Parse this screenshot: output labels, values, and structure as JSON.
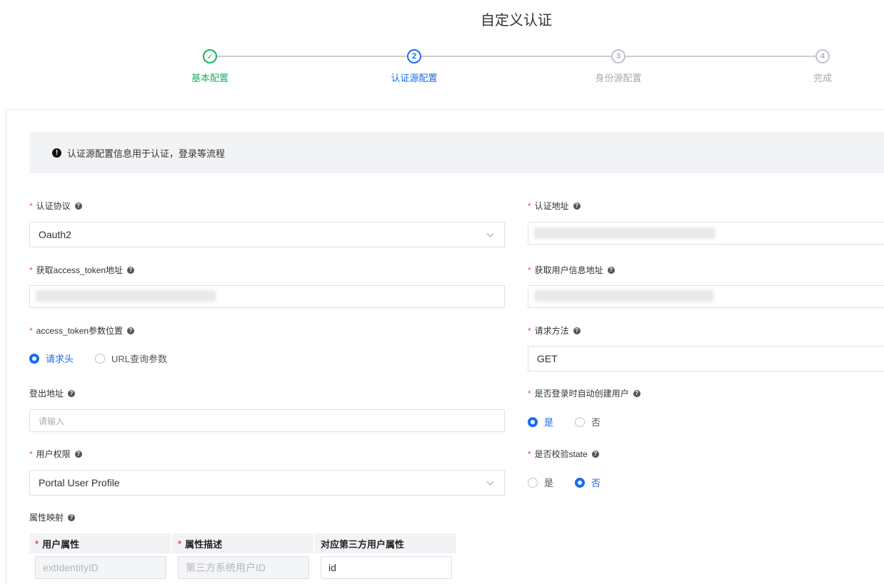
{
  "page": {
    "title": "自定义认证"
  },
  "stepper": {
    "steps": [
      {
        "number": "✓",
        "label": "基本配置",
        "state": "done"
      },
      {
        "number": "2",
        "label": "认证源配置",
        "state": "active"
      },
      {
        "number": "3",
        "label": "身份源配置",
        "state": "pending"
      },
      {
        "number": "4",
        "label": "完成",
        "state": "pending"
      }
    ]
  },
  "notice": {
    "icon": "exclamation-icon",
    "text": "认证源配置信息用于认证，登录等流程"
  },
  "form": {
    "protocol": {
      "label": "认证协议",
      "required": true,
      "value": "Oauth2"
    },
    "auth_url": {
      "label": "认证地址",
      "required": true
    },
    "token_url": {
      "label": "获取access_token地址",
      "required": true
    },
    "userinfo_url": {
      "label": "获取用户信息地址",
      "required": true
    },
    "token_position": {
      "label": "access_token参数位置",
      "required": true,
      "options": [
        "请求头",
        "URL查询参数"
      ],
      "selected": "请求头"
    },
    "request_method": {
      "label": "请求方法",
      "required": true,
      "value": "GET"
    },
    "logout_url": {
      "label": "登出地址",
      "required": false,
      "placeholder": "请输入"
    },
    "auto_create": {
      "label": "是否登录时自动创建用户",
      "required": true,
      "options": [
        "是",
        "否"
      ],
      "selected": "是"
    },
    "permission": {
      "label": "用户权限",
      "required": true,
      "value": "Portal User Profile"
    },
    "verify_state": {
      "label": "是否校验state",
      "required": true,
      "options": [
        "是",
        "否"
      ],
      "selected": "否"
    },
    "attr_mapping": {
      "label": "属性映射",
      "headers": [
        "用户属性",
        "属性描述",
        "对应第三方用户属性"
      ],
      "rows": [
        {
          "attr": "extIdentityID",
          "desc": "第三方系统用户ID",
          "third": "id"
        }
      ]
    }
  },
  "colors": {
    "primary": "#1a6cf0",
    "success": "#19b35a",
    "required": "#e34d59"
  }
}
